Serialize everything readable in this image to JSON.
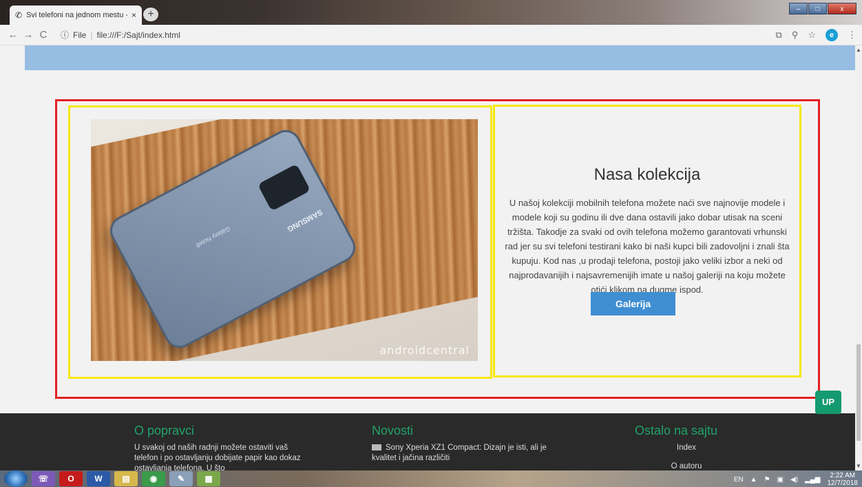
{
  "browser": {
    "tab_title": "Svi telefoni na jednom mestu - ...",
    "tab_close": "×",
    "new_tab": "+",
    "url_info": "ⓘ",
    "url_scheme": "File",
    "url": "file:///F:/Sajt/index.html",
    "profile_initial": "e",
    "window_controls": {
      "min": "–",
      "max": "□",
      "close": "x"
    }
  },
  "collection": {
    "image_watermark": "androidcentral",
    "phone_brand": "SAMSUNG",
    "phone_model": "Galaxy Note8",
    "title": "Nasa kolekcija",
    "text": "U našoj kolekciji mobilnih telefona možete naći sve najnovije modele i modele koji su godinu ili dve dana ostavili jako dobar utisak na sceni tržišta. Takodje za svaki od ovih telefona možemo garantovati vrhunski rad jer su svi telefoni testirani kako bi naši kupci bili zadovoljni i znali šta kupuju. Kod nas ,u prodaji telefona, postoji jako veliki izbor a neki od najprodavanijih i najsavremenijih imate u našoj galeriji na koju možete otići klikom na dugme ispod.",
    "button": "Galerija"
  },
  "footer": {
    "col1_title": "O popravci",
    "col1_text": "U svakoj od naših radnji možete ostaviti vaš telefon i po ostavljanju dobijate papir kao dokaz ostavljanja telefona. U što",
    "col2_title": "Novosti",
    "col2_item": "Sony Xperia XZ1 Compact: Dizajn je isti, ali je kvalitet i jačina različiti",
    "col3_title": "Ostalo na sajtu",
    "col3_links": [
      "Index",
      "O autoru"
    ]
  },
  "up_button": "UP",
  "taskbar": {
    "lang": "EN",
    "time": "2:22 AM",
    "date": "12/7/2018"
  }
}
